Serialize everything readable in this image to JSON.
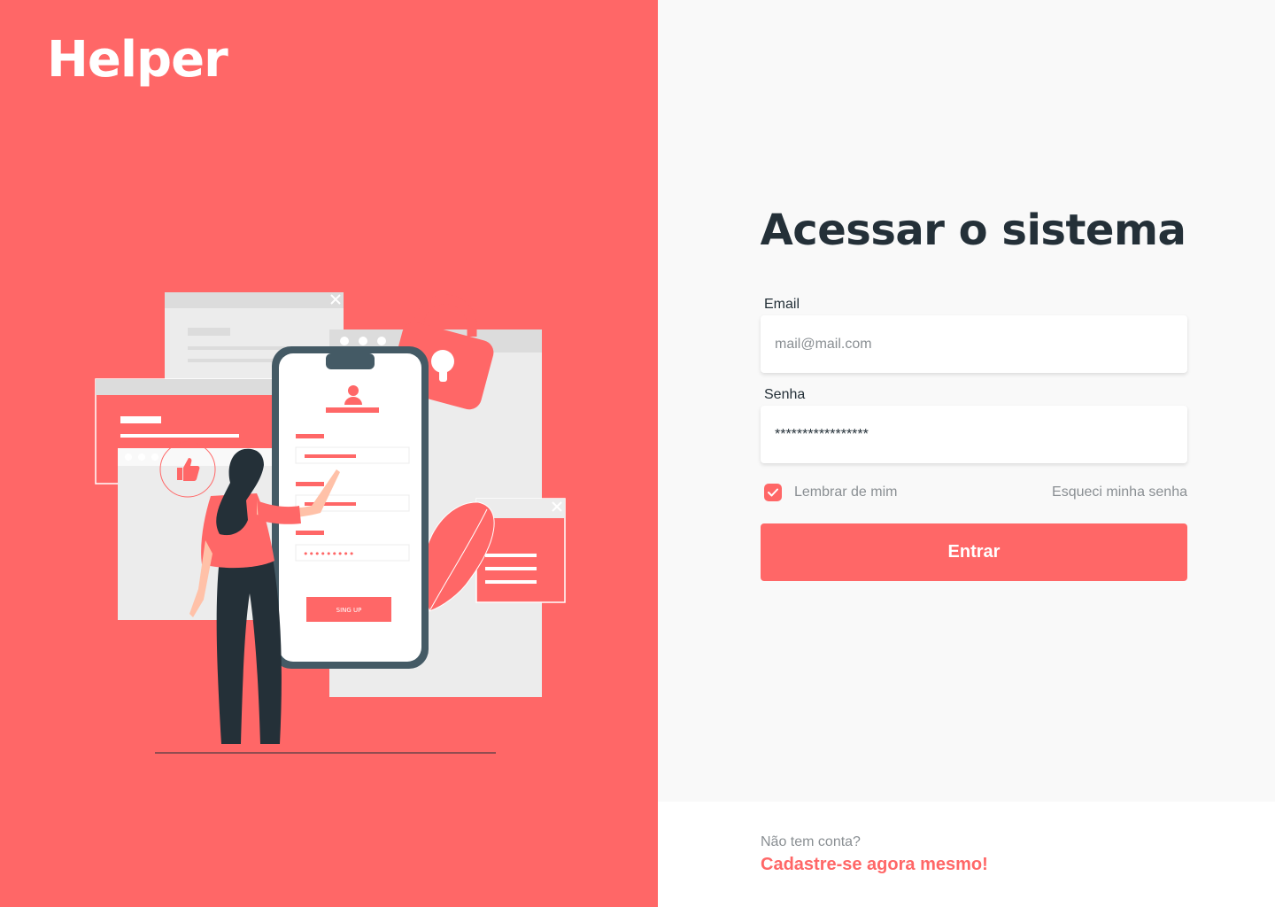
{
  "brand": {
    "logo": "Helper"
  },
  "illustration": {
    "signup_button_label": "SING UP",
    "password_dots": "•••••••••"
  },
  "login": {
    "title": "Acessar o sistema",
    "email_label": "Email",
    "email_placeholder": "mail@mail.com",
    "password_label": "Senha",
    "password_value": "*****************",
    "remember_label": "Lembrar de mim",
    "remember_checked": true,
    "forgot_label": "Esqueci minha senha",
    "submit_label": "Entrar"
  },
  "footer": {
    "no_account_text": "Não tem conta?",
    "signup_link": "Cadastre-se agora mesmo!"
  },
  "colors": {
    "brand": "#ff6767",
    "dark_text": "#243038",
    "muted_text": "#8a8f93",
    "right_background": "#f9f9f9",
    "footer_background": "#ffffff"
  },
  "icons": [
    "check-icon",
    "user-icon",
    "padlock-icon",
    "thumbs-up-icon",
    "close-icon",
    "leaf-icon"
  ]
}
